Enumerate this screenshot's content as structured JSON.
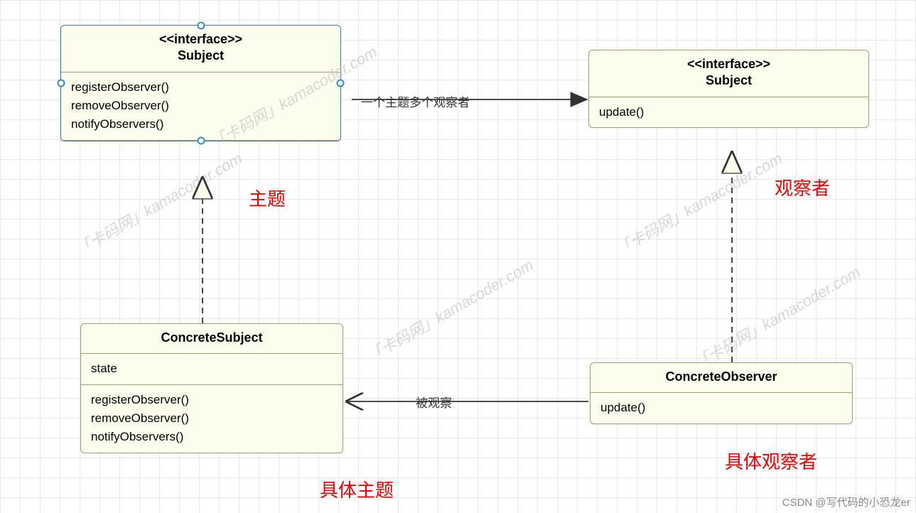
{
  "boxes": {
    "subject_interface": {
      "stereo": "<<interface>>",
      "name": "Subject",
      "methods": [
        "registerObserver()",
        "removeObserver()",
        "notifyObservers()"
      ]
    },
    "observer_interface": {
      "stereo": "<<interface>>",
      "name": "Subject",
      "methods": [
        "update()"
      ]
    },
    "concrete_subject": {
      "name": "ConcreteSubject",
      "attrs": [
        "state"
      ],
      "methods": [
        "registerObserver()",
        "removeObserver()",
        "notifyObservers()"
      ]
    },
    "concrete_observer": {
      "name": "ConcreteObserver",
      "methods": [
        "update()"
      ]
    }
  },
  "labels": {
    "subject": "主题",
    "observer": "观察者",
    "concrete_subject": "具体主题",
    "concrete_observer": "具体观察者"
  },
  "conn_labels": {
    "arrow1": "一个主题多个观察者",
    "arrow2": "被观察"
  },
  "watermark": "「卡码网」kamacoder.com",
  "credit": "CSDN @写代码的小恐龙er"
}
